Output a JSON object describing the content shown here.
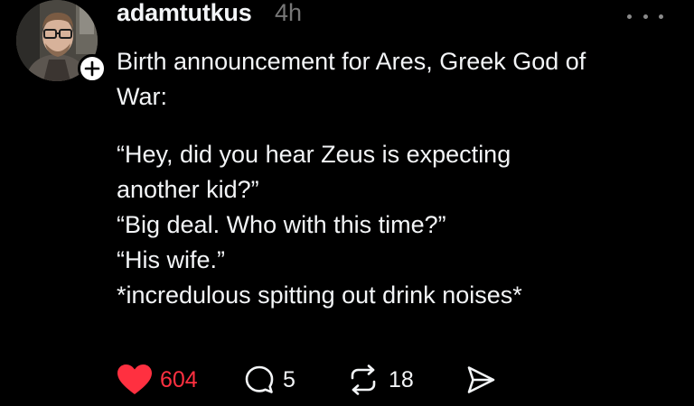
{
  "post": {
    "username": "adamtutkus",
    "timestamp": "4h",
    "text_lines": [
      "Birth announcement for Ares, Greek God of",
      "War:"
    ],
    "quote_lines": [
      "“Hey, did you hear Zeus is expecting",
      "another kid?”",
      "“Big deal. Who with this time?”",
      "“His wife.”",
      "*incredulous spitting out drink noises*"
    ]
  },
  "actions": {
    "like_count": "604",
    "reply_count": "5",
    "repost_count": "18"
  },
  "icons": {
    "like": "heart-icon",
    "reply": "comment-bubble-icon",
    "repost": "repost-arrows-icon",
    "share": "send-icon",
    "more": "more-horizontal-icon",
    "follow": "plus-icon"
  },
  "colors": {
    "background": "#000000",
    "text": "#f3f5f7",
    "muted": "#777777",
    "like_red": "#ff3040"
  }
}
